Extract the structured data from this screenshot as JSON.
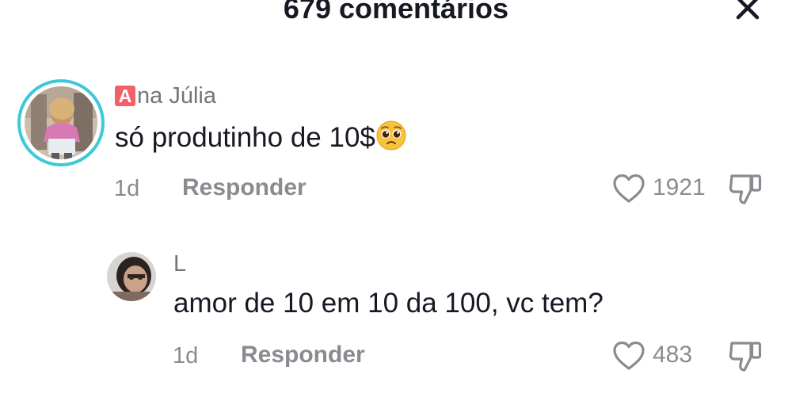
{
  "header": {
    "title": "679 comentários",
    "close_icon": "close-icon"
  },
  "comments": [
    {
      "username_badge": "A",
      "username_rest": "na Júlia",
      "text": "só produtinho de 10$",
      "emoji": "pleading-face-emoji",
      "time": "1d",
      "reply_label": "Responder",
      "likes": "1921",
      "avatar_ring_color": "#3ec9d6"
    },
    {
      "username": "L",
      "text": "amor de 10 em 10 da 100, vc tem?",
      "time": "1d",
      "reply_label": "Responder",
      "likes": "483"
    }
  ],
  "colors": {
    "primary_text": "#161823",
    "secondary_text": "#8a8b91",
    "badge_red": "#f2606a"
  }
}
